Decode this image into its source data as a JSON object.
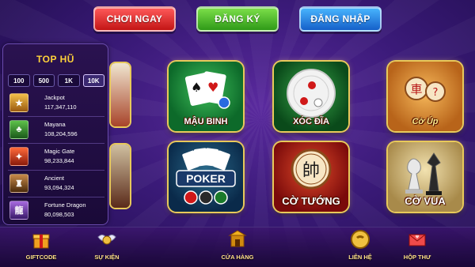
{
  "topbar": {
    "play_now": "CHƠI NGAY",
    "register": "ĐĂNG KÝ",
    "login": "ĐĂNG NHẬP"
  },
  "jackpot_panel": {
    "title": "TOP HŨ",
    "denominations": [
      "100",
      "500",
      "1K",
      "10K"
    ],
    "selected_denomination": "10K",
    "items": [
      {
        "name": "Jackpot",
        "amount": "117,347,110",
        "icon": "jackpot-icon",
        "color": "#c98a1a"
      },
      {
        "name": "Mayana",
        "amount": "108,204,596",
        "icon": "mayana-icon",
        "color": "#2e8a2e"
      },
      {
        "name": "Magic Gate",
        "amount": "98,233,844",
        "icon": "magic-gate-icon",
        "color": "#b8321a"
      },
      {
        "name": "Ancient",
        "amount": "93,094,324",
        "icon": "ancient-icon",
        "color": "#7a4a1a"
      },
      {
        "name": "Fortune Dragon",
        "amount": "80,098,503",
        "icon": "dragon-icon",
        "color": "#5a2a8a"
      }
    ]
  },
  "games": [
    {
      "label": "MẬU BINH",
      "icon": "cards-icon"
    },
    {
      "label": "XÓC ĐĨA",
      "icon": "dish-icon"
    },
    {
      "label": "Cờ Úp",
      "icon": "hidden-chess-icon"
    },
    {
      "label": "POKER",
      "icon": "poker-icon"
    },
    {
      "label": "CỜ TƯỚNG",
      "icon": "chinese-chess-icon"
    },
    {
      "label": "CỜ VUA",
      "icon": "chess-icon"
    }
  ],
  "chinese_chars": {
    "xe": "車",
    "question": "?",
    "soai": "帥"
  },
  "bottom_nav": {
    "giftcode": "GIFTCODE",
    "events": "SỰ KIỆN",
    "shop": "CỬA HÀNG",
    "contact": "LIÊN HỆ",
    "mailbox": "HỘP THƯ"
  },
  "colors": {
    "accent_gold": "#e8c95a",
    "play_now_red": "#d92222",
    "register_green": "#3aa820",
    "login_blue": "#1e78e0",
    "jackpot_title": "#ffd23a"
  }
}
